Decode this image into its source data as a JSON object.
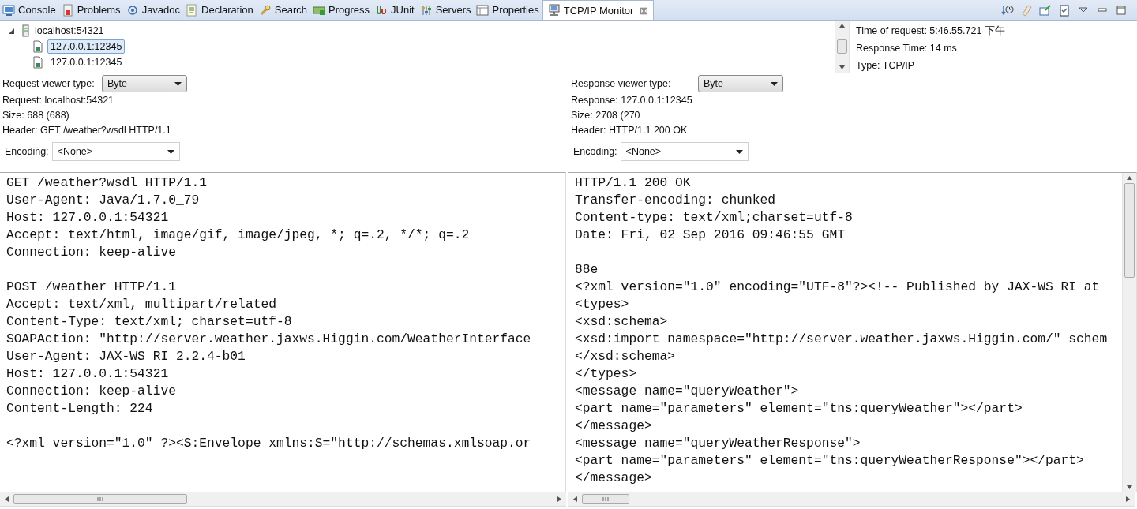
{
  "view_tabs": [
    {
      "label": "Console",
      "selected": false
    },
    {
      "label": "Problems",
      "selected": false
    },
    {
      "label": "Javadoc",
      "selected": false
    },
    {
      "label": "Declaration",
      "selected": false
    },
    {
      "label": "Search",
      "selected": false
    },
    {
      "label": "Progress",
      "selected": false
    },
    {
      "label": "JUnit",
      "selected": false
    },
    {
      "label": "Servers",
      "selected": false
    },
    {
      "label": "Properties",
      "selected": false
    },
    {
      "label": "TCP/IP Monitor",
      "selected": true,
      "close": "⊠"
    }
  ],
  "tree": {
    "label": "localhost:54321",
    "expanded": true,
    "children": [
      {
        "label": "127.0.0.1:12345",
        "selected": true
      },
      {
        "label": "127.0.0.1:12345",
        "selected": false
      }
    ]
  },
  "info": [
    "Time of request: 5:46.55.721 下午",
    "Response Time: 14 ms",
    "Type: TCP/IP"
  ],
  "panes": [
    {
      "viewer_label": "Request viewer type:",
      "viewer_type": "Byte",
      "details": [
        "Request: localhost:54321",
        "Size: 688 (688)",
        "Header: GET /weather?wsdl HTTP/1.1"
      ],
      "encoding_label": "Encoding:",
      "encoding": "<None>",
      "content": [
        [
          "GET /weather?wsdl HTTP/1.1",
          "User-Agent: Java/1.7.0_79",
          "Host: 127.0.0.1:54321",
          "Accept: text/html, image/gif, image/jpeg, *; q=.2, */*; q=.2",
          "Connection: keep-alive"
        ],
        [
          "POST /weather HTTP/1.1",
          "Accept: text/xml, multipart/related",
          "Content-Type: text/xml; charset=utf-8",
          "SOAPAction: \"http://server.weather.jaxws.Higgin.com/WeatherInterface",
          "User-Agent: JAX-WS RI 2.2.4-b01",
          "Host: 127.0.0.1:54321",
          "Connection: keep-alive",
          "Content-Length: 224"
        ],
        [
          "<?xml version=\"1.0\" ?><S:Envelope xmlns:S=\"http://schemas.xmlsoap.or"
        ]
      ]
    },
    {
      "viewer_label": "Response viewer type:",
      "viewer_type": "Byte",
      "details": [
        "Response: 127.0.0.1:12345",
        "Size: 2708 (270",
        "Header: HTTP/1.1 200 OK"
      ],
      "encoding_label": "Encoding:",
      "encoding": "<None>",
      "content": [
        [
          "HTTP/1.1 200 OK",
          "Transfer-encoding: chunked",
          "Content-type: text/xml;charset=utf-8",
          "Date: Fri, 02 Sep 2016 09:46:55 GMT"
        ],
        [
          "88e",
          "<?xml version=\"1.0\" encoding=\"UTF-8\"?><!-- Published by JAX-WS RI at",
          "<types>",
          "<xsd:schema>",
          "<xsd:import namespace=\"http://server.weather.jaxws.Higgin.com/\" schem",
          "</xsd:schema>",
          "</types>",
          "<message name=\"queryWeather\">",
          "<part name=\"parameters\" element=\"tns:queryWeather\"></part>",
          "</message>",
          "<message name=\"queryWeatherResponse\">",
          "<part name=\"parameters\" element=\"tns:queryWeatherResponse\"></part>",
          "</message>"
        ]
      ]
    }
  ]
}
